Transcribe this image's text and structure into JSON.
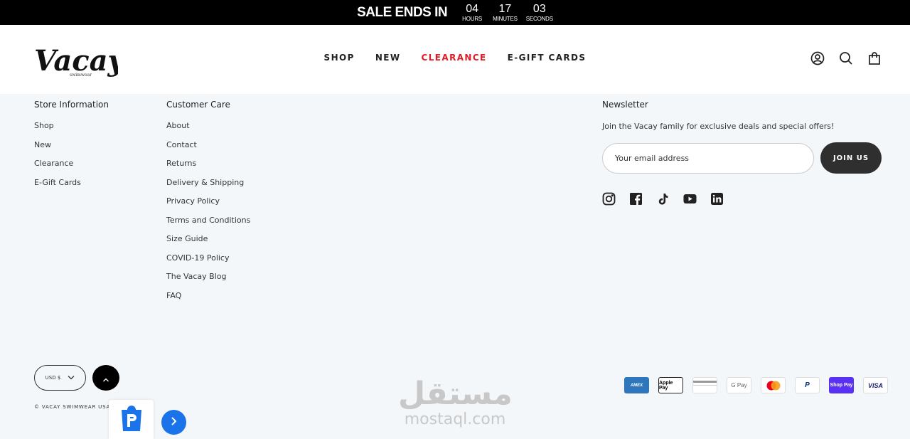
{
  "salebar": {
    "title": "SALE ENDS IN",
    "countdown": [
      {
        "num": "04",
        "label": "HOURS"
      },
      {
        "num": "17",
        "label": "MINUTES"
      },
      {
        "num": "03",
        "label": "SECONDS"
      }
    ]
  },
  "header": {
    "logo_text": "Vacay",
    "logo_sub": "swimwear",
    "nav": [
      "SHOP",
      "NEW",
      "CLEARANCE",
      "E-GIFT CARDS"
    ],
    "icons": [
      "account-icon",
      "search-icon",
      "cart-icon"
    ]
  },
  "footer": {
    "store_info": {
      "title": "Store Information",
      "items": [
        "Shop",
        "New",
        "Clearance",
        "E-Gift Cards"
      ]
    },
    "customer_care": {
      "title": "Customer Care",
      "items": [
        "About",
        "Contact",
        "Returns",
        "Delivery & Shipping",
        "Privacy Policy",
        "Terms and Conditions",
        "Size Guide",
        "COVID-19 Policy",
        "The Vacay Blog",
        "FAQ"
      ]
    },
    "newsletter": {
      "title": "Newsletter",
      "text": "Join the Vacay family for exclusive deals and special offers!",
      "placeholder": "Your email address",
      "button": "JOIN US",
      "social": [
        "instagram-icon",
        "facebook-icon",
        "tiktok-icon",
        "youtube-icon",
        "linkedin-icon"
      ]
    },
    "currency": "USD $",
    "copyright": "© VACAY SWIMWEAR USA",
    "payments": [
      "AMEX",
      "Apple Pay",
      "",
      "G Pay",
      "",
      "P",
      "Shop Pay",
      "VISA"
    ]
  },
  "watermark": {
    "arabic": "مستقل",
    "latin": "mostaql.com"
  },
  "colors": {
    "accent_red": "#e01b24",
    "dark_button": "#2f2f2f",
    "link_blue": "#1a73e8",
    "bg": "#f4f7f9"
  }
}
